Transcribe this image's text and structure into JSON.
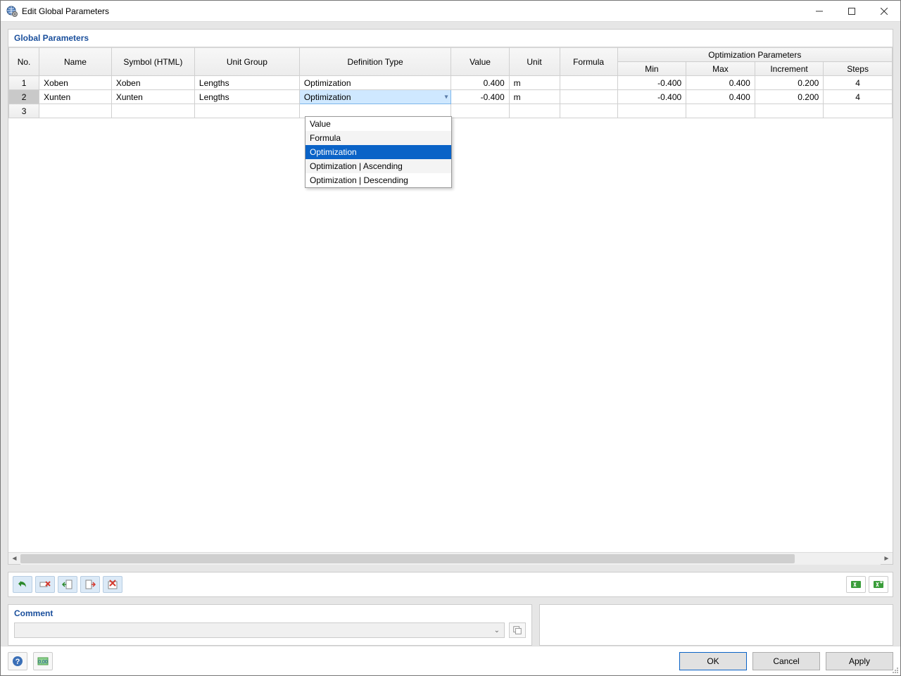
{
  "window": {
    "title": "Edit Global Parameters"
  },
  "panel": {
    "title": "Global Parameters"
  },
  "headers": {
    "no": "No.",
    "name": "Name",
    "symbol": "Symbol (HTML)",
    "unit_group": "Unit Group",
    "def_type": "Definition Type",
    "value": "Value",
    "unit": "Unit",
    "formula": "Formula",
    "opt_group": "Optimization Parameters",
    "min": "Min",
    "max": "Max",
    "increment": "Increment",
    "steps": "Steps"
  },
  "rows": [
    {
      "no": "1",
      "name": "Xoben",
      "symbol": "Xoben",
      "unit_group": "Lengths",
      "def_type": "Optimization",
      "value": "0.400",
      "unit": "m",
      "formula": "",
      "min": "-0.400",
      "max": "0.400",
      "increment": "0.200",
      "steps": "4"
    },
    {
      "no": "2",
      "name": "Xunten",
      "symbol": "Xunten",
      "unit_group": "Lengths",
      "def_type": "Optimization",
      "value": "-0.400",
      "unit": "m",
      "formula": "",
      "min": "-0.400",
      "max": "0.400",
      "increment": "0.200",
      "steps": "4"
    },
    {
      "no": "3",
      "name": "",
      "symbol": "",
      "unit_group": "",
      "def_type": "",
      "value": "",
      "unit": "",
      "formula": "",
      "min": "",
      "max": "",
      "increment": "",
      "steps": ""
    }
  ],
  "dropdown": {
    "selected": "Optimization",
    "items": [
      "Value",
      "Formula",
      "Optimization",
      "Optimization | Ascending",
      "Optimization | Descending"
    ],
    "highlight_index": 2
  },
  "comment": {
    "label": "Comment",
    "value": ""
  },
  "buttons": {
    "ok": "OK",
    "cancel": "Cancel",
    "apply": "Apply"
  },
  "icons": {
    "app": "globe-gear-icon",
    "toolbar": [
      "undo-icon",
      "delete-row-icon",
      "shift-left-icon",
      "shift-right-icon",
      "delete-all-icon"
    ],
    "excel": [
      "excel-export-icon",
      "excel-import-icon"
    ],
    "help": "help-icon",
    "units": "units-icon"
  }
}
